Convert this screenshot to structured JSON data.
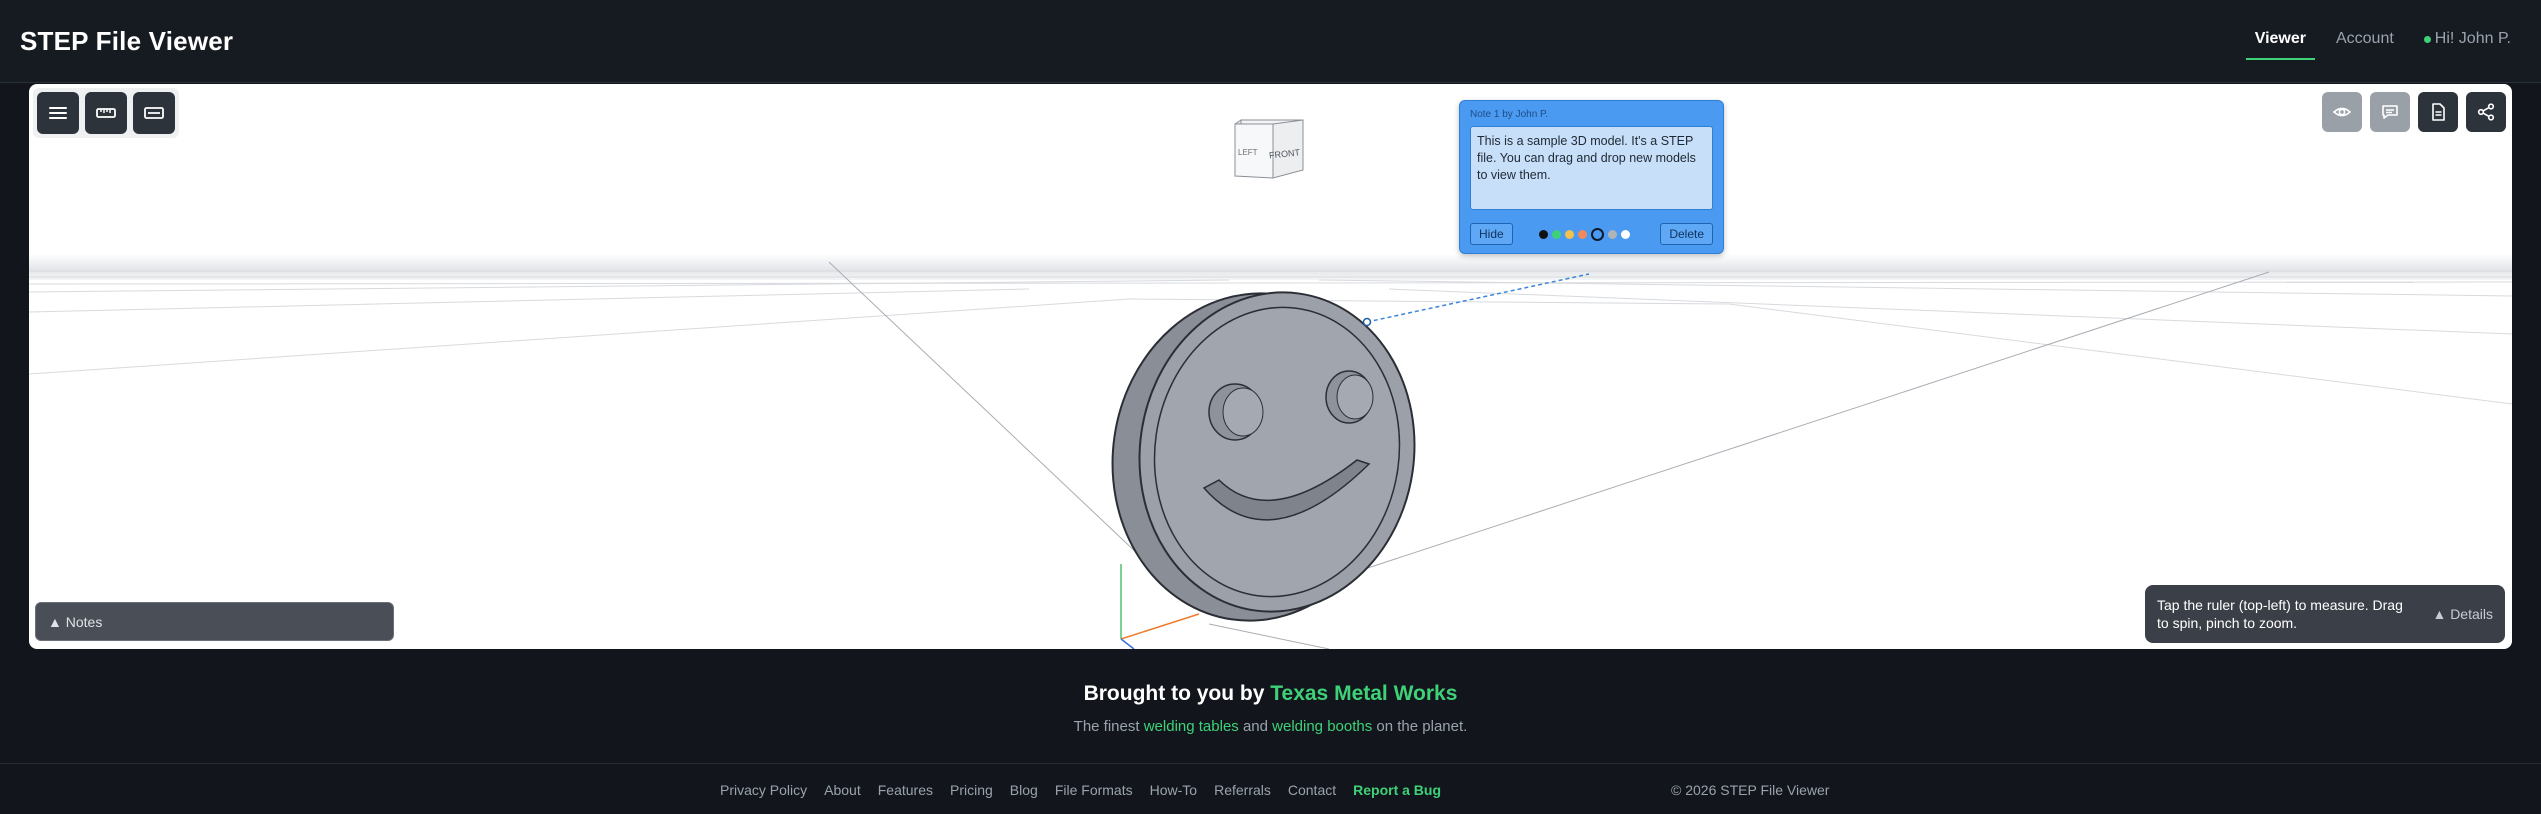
{
  "header": {
    "title": "STEP File Viewer",
    "nav": [
      {
        "label": "Viewer",
        "active": true
      },
      {
        "label": "Account",
        "active": false
      }
    ],
    "greeting": "Hi! John P."
  },
  "viewer": {
    "toolbar_icons": [
      "menu-icon",
      "ruler-icon",
      "section-icon"
    ],
    "right_tool_icons": [
      "eye-icon",
      "comment-icon",
      "document-icon",
      "share-icon"
    ],
    "view_cube": {
      "front": "FRONT",
      "left": "LEFT"
    },
    "note": {
      "header": "Note 1 by John P.",
      "text": "This is a sample 3D model. It's a STEP file. You can drag and drop new models to view them.",
      "hide_label": "Hide",
      "delete_label": "Delete",
      "colors": [
        "#111111",
        "#3fd178",
        "#f2c14e",
        "#f08a5d",
        "#4a9af2",
        "#b0b4b9",
        "#ffffff"
      ],
      "selected_color_index": 4
    },
    "notes_bar_label": "▲ Notes",
    "hint": {
      "text": "Tap the ruler (top-left) to measure. Drag to spin, pinch to zoom.",
      "details_label": "▲ Details"
    }
  },
  "footer": {
    "promo_prefix": "Brought to you by ",
    "promo_link": "Texas Metal Works",
    "sub_prefix": "The finest ",
    "sub_link1": "welding tables",
    "sub_mid": " and ",
    "sub_link2": "welding booths",
    "sub_suffix": " on the planet.",
    "links": [
      "Privacy Policy",
      "About",
      "Features",
      "Pricing",
      "Blog",
      "File Formats",
      "How-To",
      "Referrals",
      "Contact"
    ],
    "bug_label": "Report a Bug",
    "copyright": "© 2026 STEP File Viewer"
  },
  "colors": {
    "accent": "#3fd178",
    "note": "#4a9af2",
    "background": "#12161c"
  }
}
